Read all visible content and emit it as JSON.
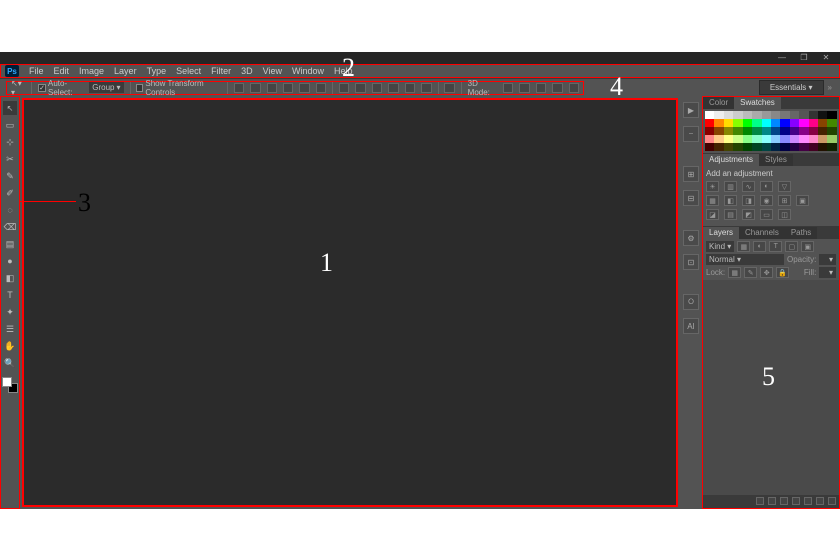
{
  "app_name": "Ps",
  "menu": [
    "File",
    "Edit",
    "Image",
    "Layer",
    "Type",
    "Select",
    "Filter",
    "3D",
    "View",
    "Window",
    "Help"
  ],
  "options": {
    "auto_select": {
      "checked": true,
      "label": "Auto-Select:"
    },
    "group_select": "Group",
    "show_transform": {
      "checked": false,
      "label": "Show Transform Controls"
    },
    "mode_3d": "3D Mode:"
  },
  "workspace": "Essentials",
  "tools": [
    "↖",
    "▭",
    "⊹",
    "✂",
    "✎",
    "✐",
    "◌",
    "⌫",
    "▤",
    "●",
    "◧",
    "T",
    "✦",
    "☰",
    "✋",
    "🔍"
  ],
  "mid_dock": [
    "▶",
    "⎯",
    "⊞",
    "⊟",
    "⚙",
    "⊡",
    "୦",
    "Aǀ"
  ],
  "panels": {
    "color": {
      "tabs": [
        "Color",
        "Swatches"
      ],
      "active": 1
    },
    "adjustments": {
      "tabs": [
        "Adjustments",
        "Styles"
      ],
      "active": 0,
      "title": "Add an adjustment"
    },
    "layers": {
      "tabs": [
        "Layers",
        "Channels",
        "Paths"
      ],
      "active": 0,
      "kind": "Kind",
      "blend": "Normal",
      "opacity_label": "Opacity:",
      "lock_label": "Lock:",
      "fill_label": "Fill:"
    }
  },
  "swatch_colors": [
    [
      "#ffffff",
      "#eeeeee",
      "#dddddd",
      "#cccccc",
      "#bbbbbb",
      "#aaaaaa",
      "#999999",
      "#888888",
      "#777777",
      "#666666",
      "#555555",
      "#333333",
      "#111111",
      "#000000"
    ],
    [
      "#ff0000",
      "#ff8800",
      "#ffdd00",
      "#88ff00",
      "#00ff00",
      "#00ff88",
      "#00ffff",
      "#0088ff",
      "#0000ff",
      "#8800ff",
      "#ff00ff",
      "#ff0088",
      "#884400",
      "#448800"
    ],
    [
      "#880000",
      "#884400",
      "#888800",
      "#448800",
      "#008800",
      "#008844",
      "#008888",
      "#004488",
      "#000088",
      "#440088",
      "#880088",
      "#880044",
      "#442200",
      "#224400"
    ],
    [
      "#ff8888",
      "#ffcc88",
      "#ffff88",
      "#ccff88",
      "#88ff88",
      "#88ffcc",
      "#88ffff",
      "#88ccff",
      "#8888ff",
      "#cc88ff",
      "#ff88ff",
      "#ff88cc",
      "#cc9966",
      "#99cc66"
    ],
    [
      "#440000",
      "#442200",
      "#444400",
      "#224400",
      "#004400",
      "#004422",
      "#004444",
      "#002244",
      "#000044",
      "#220044",
      "#440044",
      "#440022",
      "#221100",
      "#112200"
    ]
  ],
  "annotations": {
    "1": "1",
    "2": "2",
    "3": "3",
    "4": "4",
    "5": "5"
  }
}
